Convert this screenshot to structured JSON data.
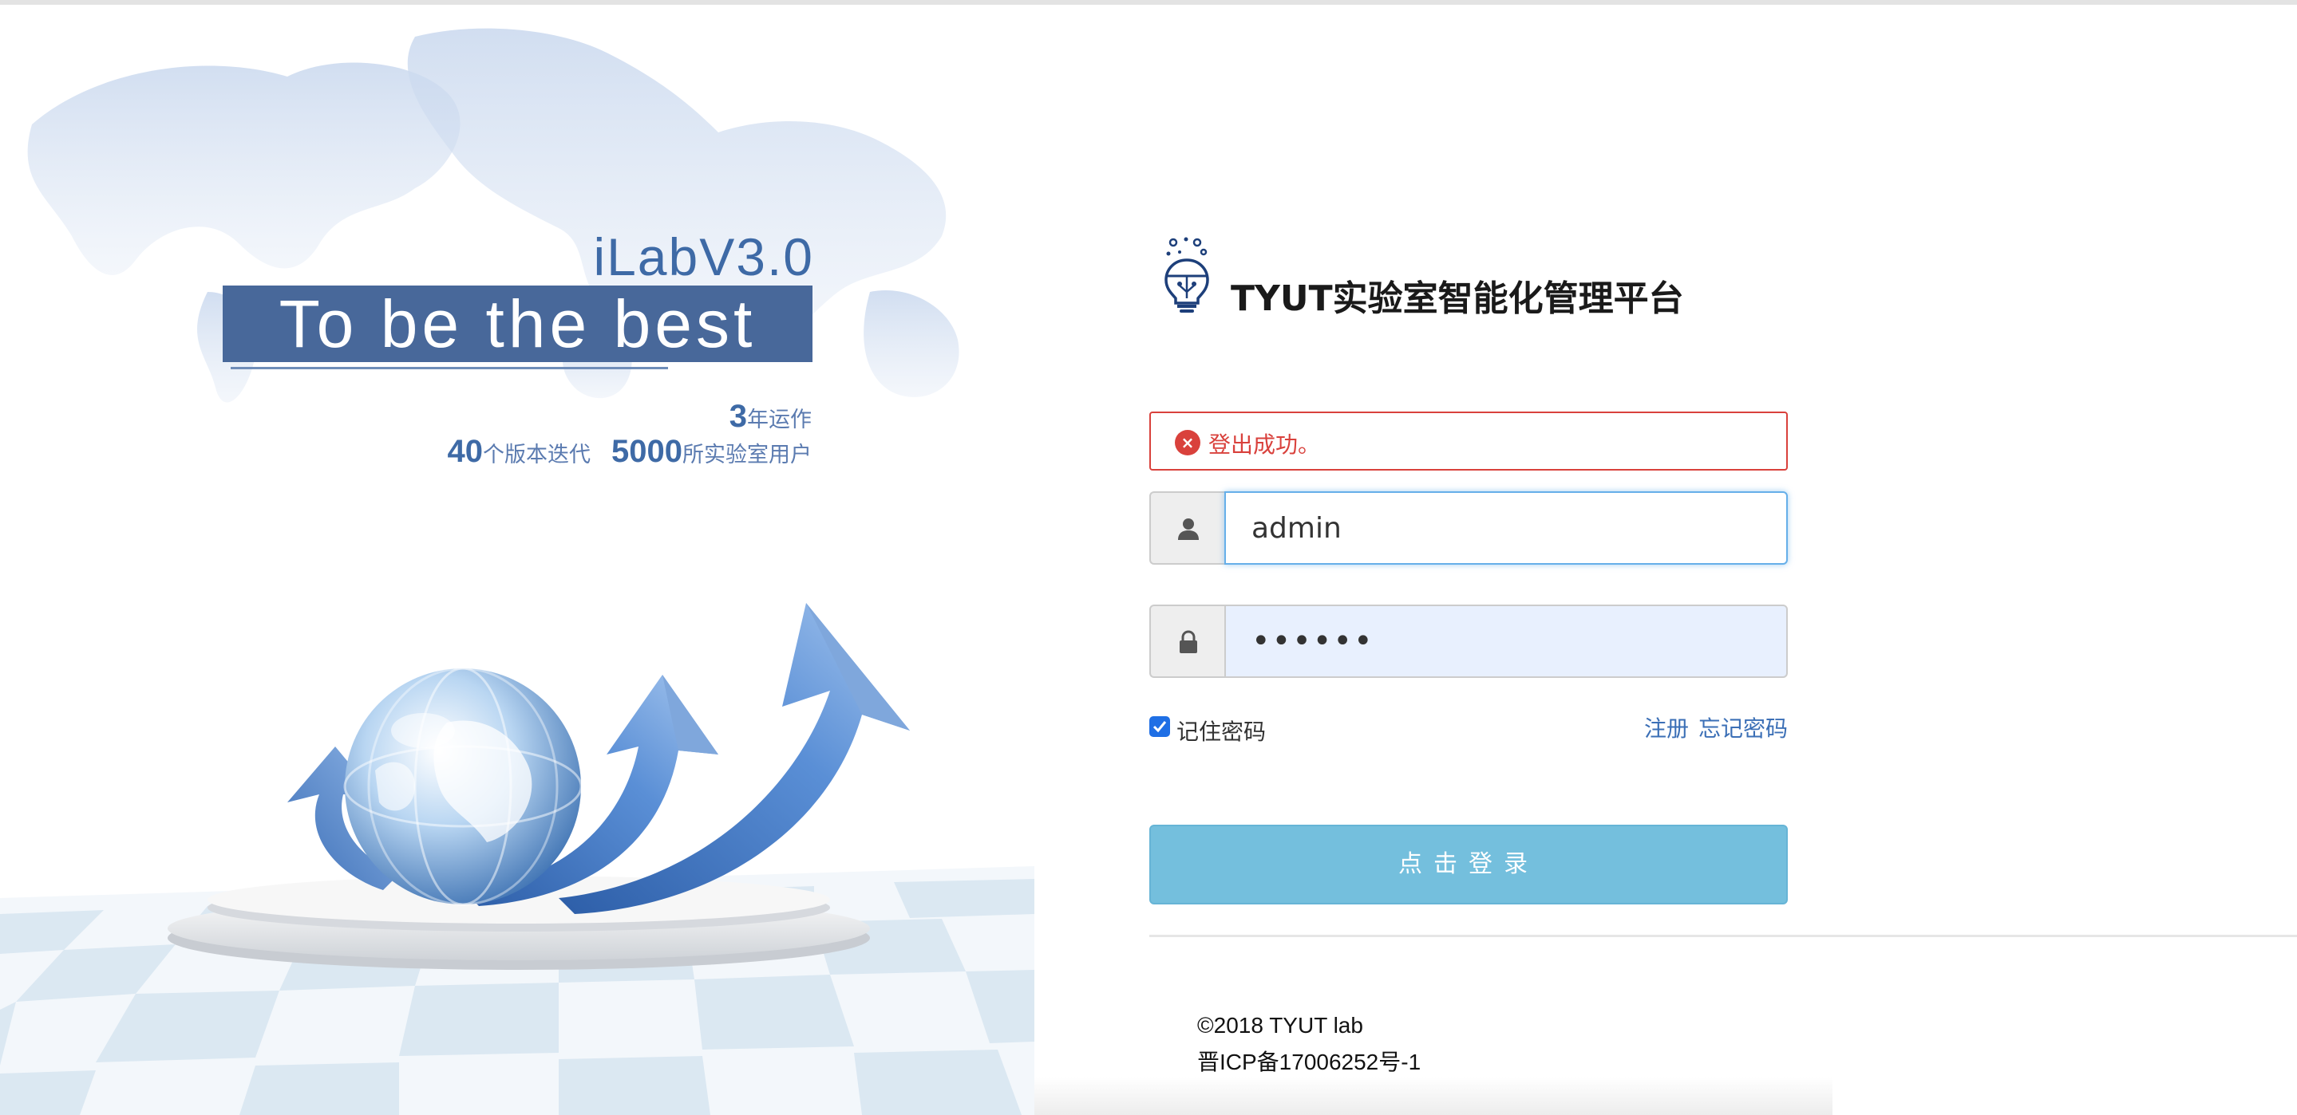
{
  "hero": {
    "brand_version": "iLabV3.0",
    "slogan": "To be the best",
    "stats": {
      "years_num": "3",
      "years_label": "年运作",
      "versions_num": "40",
      "versions_label": "个版本迭代",
      "users_num": "5000",
      "users_label": "所实验室用户"
    },
    "illustration": "globe-and-rising-arrows"
  },
  "login": {
    "logo": "lightbulb-icon",
    "title": "TYUT实验室智能化管理平台",
    "alert": {
      "type": "error",
      "icon": "error-circle-icon",
      "message": "登出成功。"
    },
    "username": {
      "icon": "user-icon",
      "value": "admin",
      "placeholder": ""
    },
    "password": {
      "icon": "lock-icon",
      "value": "••••••",
      "placeholder": ""
    },
    "remember": {
      "label": "记住密码",
      "checked": true
    },
    "links": {
      "register": "注册",
      "forgot": "忘记密码"
    },
    "submit_label": "点击登录"
  },
  "footer": {
    "copyright": "©2018 TYUT lab",
    "icp": "晋ICP备17006252号-1"
  },
  "colors": {
    "brand_blue": "#48689a",
    "alert_red": "#d9413c",
    "button_blue": "#74bfdd",
    "link_blue": "#3b6fb6",
    "input_focus": "#66afe9"
  }
}
